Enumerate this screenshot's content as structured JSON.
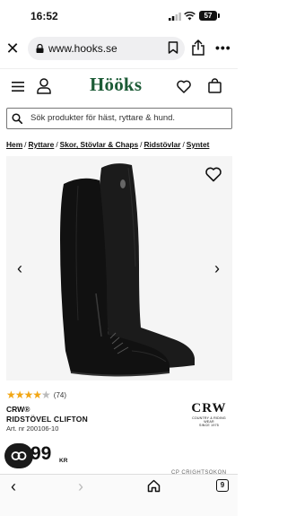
{
  "status_bar": {
    "time": "16:52",
    "battery": "57",
    "icons": [
      "signal-icon",
      "wifi-icon",
      "battery-icon"
    ]
  },
  "browser": {
    "url": "www.hooks.se",
    "icons": [
      "close-icon",
      "lock-icon",
      "bookmark-icon",
      "share-icon",
      "more-icon"
    ],
    "bottom_icons": [
      "back-icon",
      "forward-icon",
      "home-icon",
      "tabs-icon"
    ],
    "tab_count": "9"
  },
  "site": {
    "logo": "Hööks",
    "brand_color": "#1c5b36",
    "search_placeholder": "Sök produkter för häst, ryttare & hund."
  },
  "breadcrumb": {
    "items": [
      "Hem",
      "Ryttare",
      "Skor, Stövlar & Chaps",
      "Ridstövlar",
      "Syntet"
    ],
    "separator": "/"
  },
  "product": {
    "rating_count": "(74)",
    "rating_stars": 4,
    "rating_max": 5,
    "brand": "CRW®",
    "name": "RIDSTÖVEL CLIFTON",
    "article_number": "Art. nr 200106-10",
    "price_visible": "99",
    "currency": "KR",
    "brand_logo": {
      "name": "CRW",
      "tagline_line1": "COUNTRY & RIDING WEAR",
      "tagline_line2": "SINCE 1975"
    },
    "accent_color": "#f2a614"
  },
  "footer_peek": "CP CRIGHTSOKON"
}
